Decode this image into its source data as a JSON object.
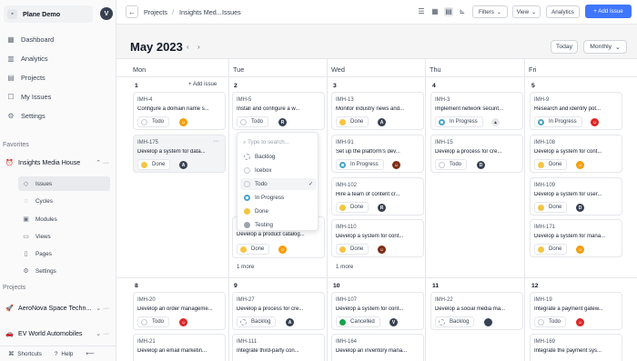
{
  "workspace": {
    "name": "Plane Demo",
    "avatar": "V"
  },
  "nav": [
    {
      "label": "Dashboard",
      "icon": "▦"
    },
    {
      "label": "Analytics",
      "icon": "▥"
    },
    {
      "label": "Projects",
      "icon": "▤"
    },
    {
      "label": "My Issues",
      "icon": "☐"
    },
    {
      "label": "Settings",
      "icon": "⚙"
    }
  ],
  "favorites": {
    "title": "Favorites",
    "project": "Insights Media House",
    "subitems": [
      "Issues",
      "Cycles",
      "Modules",
      "Views",
      "Pages",
      "Settings"
    ]
  },
  "projects": {
    "title": "Projects",
    "items": [
      {
        "name": "AeroNova Space Techn..."
      },
      {
        "name": "EV World Automobiles"
      }
    ]
  },
  "footer": {
    "shortcuts": "Shortcuts",
    "help": "Help",
    "collapse": "⟵"
  },
  "header": {
    "crumb1": "Projects",
    "crumb2": "Insights Med...",
    "crumb3": "Issues",
    "filters": "Filters",
    "view": "View",
    "analytics": "Analytics",
    "add_issue": "+ Add Issue"
  },
  "calendar": {
    "month": "May 2023",
    "today": "Today",
    "layout": "Monthly",
    "days": [
      "Mon",
      "Tue",
      "Wed",
      "Thu",
      "Fri"
    ],
    "add_issue_label": "+ Add issue",
    "more_label": "1 more",
    "dates": [
      "1",
      "2",
      "3",
      "4",
      "5",
      "8",
      "9",
      "10",
      "11",
      "12"
    ]
  },
  "cards": [
    {
      "id": "IMH-4",
      "title": "Configure a domain name s...",
      "state": "Todo"
    },
    {
      "id": "IMH-175",
      "title": "Develop a system for data...",
      "state": "Done"
    },
    {
      "id": "IMH-5",
      "title": "Install and configure a w...",
      "state": "Todo",
      "avatar": "R"
    },
    {
      "id": "",
      "title": "Develop a product catalog...",
      "state": "Done"
    },
    {
      "id": "IMH-13",
      "title": "Monitor industry news and...",
      "state": "Done",
      "avatar": "A"
    },
    {
      "id": "IMH-91",
      "title": "Set up the platform's dev...",
      "state": "In Progress"
    },
    {
      "id": "IMH-102",
      "title": "Hire a team of content cr...",
      "state": "Done",
      "avatar": "R"
    },
    {
      "id": "IMH-110",
      "title": "Develop a system for cont...",
      "state": "Done"
    },
    {
      "id": "IMH-3",
      "title": "Implement network securit...",
      "state": "In Progress"
    },
    {
      "id": "IMH-15",
      "title": "Develop a process for cre...",
      "state": "Todo",
      "avatar": "D"
    },
    {
      "id": "IMH-9",
      "title": "Research and identify pot...",
      "state": "In Progress"
    },
    {
      "id": "IMH-108",
      "title": "Develop a system for cont...",
      "state": "Done"
    },
    {
      "id": "IMH-109",
      "title": "Develop a system for user...",
      "state": "Done",
      "avatar": "D"
    },
    {
      "id": "IMH-171",
      "title": "Develop a system for mana...",
      "state": "Done"
    },
    {
      "id": "IMH-20",
      "title": "Develop an order manageme...",
      "state": "Todo"
    },
    {
      "id": "IMH-21",
      "title": "Develop an email marketin...",
      "state": ""
    },
    {
      "id": "IMH-27",
      "title": "Develop a process for cre...",
      "state": "Backlog",
      "avatar": "A"
    },
    {
      "id": "IMH-111",
      "title": "Integrate third-party con...",
      "state": ""
    },
    {
      "id": "IMH-107",
      "title": "Develop a system for cont...",
      "state": "Cancelled",
      "avatar": "V"
    },
    {
      "id": "IMH-164",
      "title": "Develop an inventory mana...",
      "state": ""
    },
    {
      "id": "IMH-22",
      "title": "Develop a social media ma...",
      "state": "Backlog"
    },
    {
      "id": "IMH-19",
      "title": "Integrate a payment gatew...",
      "state": "Todo"
    },
    {
      "id": "IMH-169",
      "title": "Integrate the payment sys...",
      "state": ""
    }
  ],
  "dropdown": {
    "placeholder": "Type to search...",
    "options": [
      "Backlog",
      "Icebox",
      "Todo",
      "In Progress",
      "Done",
      "Testing"
    ],
    "selected_mark": "✓"
  },
  "colors": {
    "accent": "#3f76ff",
    "done": "#f4c542",
    "in_progress": "#4ba3c7",
    "cancelled": "#16a34a",
    "backlog": "#c7cbd1"
  }
}
